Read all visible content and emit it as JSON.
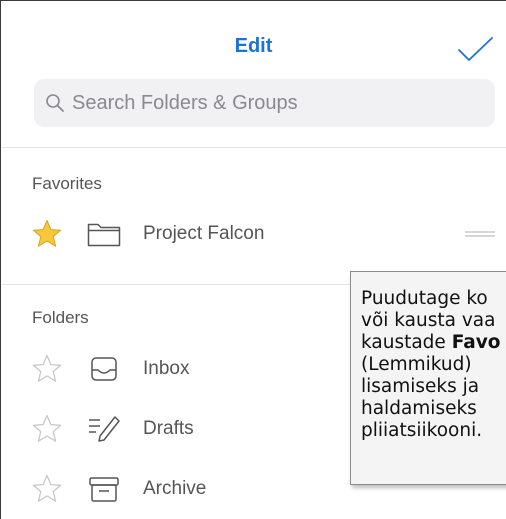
{
  "header": {
    "title": "Edit"
  },
  "search": {
    "placeholder": "Search Folders & Groups",
    "value": ""
  },
  "favorites": {
    "header": "Favorites",
    "items": [
      {
        "label": "Project Falcon",
        "starred": true,
        "icon": "folder-icon"
      }
    ]
  },
  "folders": {
    "header": "Folders",
    "items": [
      {
        "label": "Inbox",
        "starred": false,
        "icon": "inbox-tray-icon"
      },
      {
        "label": "Drafts",
        "starred": false,
        "icon": "drafts-pencil-icon"
      },
      {
        "label": "Archive",
        "starred": false,
        "icon": "archive-box-icon"
      }
    ]
  },
  "tooltip": {
    "line1": "Puudutage ko",
    "line2": "või kausta vaa",
    "line3_pre": "kaustade ",
    "line3_bold": "Favo",
    "line4": "(Lemmikud)",
    "line5": "lisamiseks ja",
    "line6": "haldamiseks",
    "line7": "pliiatsiikooni."
  },
  "colors": {
    "accent": "#1a73d6",
    "star_filled": "#f8c73c",
    "star_outline": "#c8c8cc",
    "icon_gray": "#555555",
    "search_bg": "#f1f1f3"
  }
}
